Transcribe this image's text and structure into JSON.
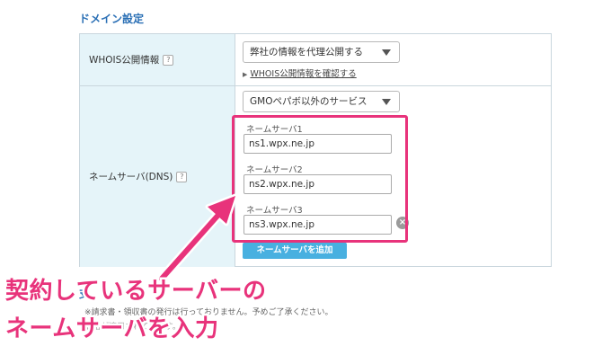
{
  "section_title": "ドメイン設定",
  "whois": {
    "label": "WHOIS公開情報",
    "help": "?",
    "select_value": "弊社の情報を代理公開する",
    "link": "WHOIS公開情報を確認する",
    "link_prefix": "▶"
  },
  "nameserver": {
    "label": "ネームサーバ(DNS)",
    "help": "?",
    "select_value": "GMOペパボ以外のサービス",
    "fields": [
      {
        "label": "ネームサーバ1",
        "value": "ns1.wpx.ne.jp"
      },
      {
        "label": "ネームサーバ2",
        "value": "ns2.wpx.ne.jp"
      },
      {
        "label": "ネームサーバ3",
        "value": "ns3.wpx.ne.jp"
      }
    ],
    "remove_icon": "×",
    "add_button": "ネームサーバを追加"
  },
  "bottom": {
    "heading": "支",
    "note1": "※請求書・領収書の発行は行っておりません。予めご了承ください。",
    "note2": "価格が適用されています。"
  },
  "overlay": {
    "line1": "契約しているサーバーの",
    "line2": "ネームサーバを入力",
    "color": "#e8337b"
  }
}
